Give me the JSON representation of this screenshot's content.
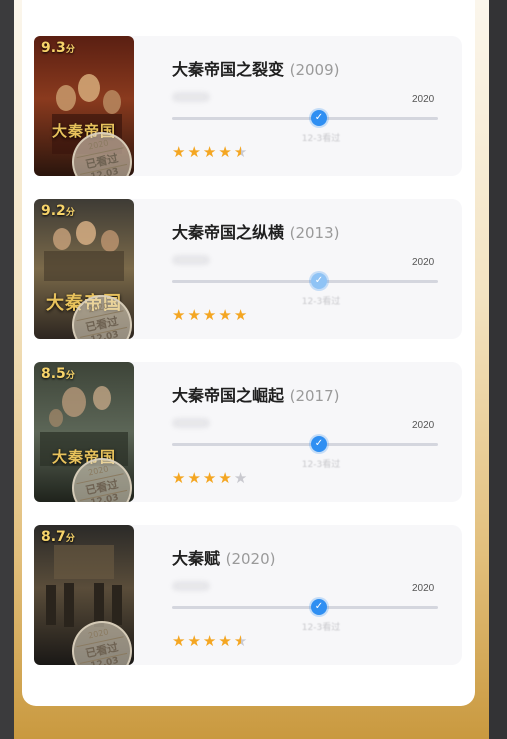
{
  "movies": [
    {
      "score": "9.3",
      "score_unit": "分",
      "poster_title": "大秦帝国",
      "title": "大秦帝国之裂变",
      "year": "(2009)",
      "track_end_label": "2020",
      "knob_label": "12-3看过",
      "rating": 4.5,
      "stamp": {
        "year": "2020",
        "text": "已看过",
        "date": "12.03"
      },
      "colors": {
        "top": "#5a1f12",
        "mid": "#8a3a1e",
        "bottom": "#2a150d"
      }
    },
    {
      "score": "9.2",
      "score_unit": "分",
      "poster_title": "大秦帝国",
      "title": "大秦帝国之纵横",
      "year": "(2013)",
      "track_end_label": "2020",
      "knob_label": "12-3看过",
      "rating": 5,
      "stamp": {
        "year": "2020",
        "text": "已看过",
        "date": "12.03"
      },
      "colors": {
        "top": "#3e3b35",
        "mid": "#7b6a4a",
        "bottom": "#2d2620"
      }
    },
    {
      "score": "8.5",
      "score_unit": "分",
      "poster_title": "大秦帝国",
      "title": "大秦帝国之崛起",
      "year": "(2017)",
      "track_end_label": "2020",
      "knob_label": "12-3看过",
      "rating": 4,
      "stamp": {
        "year": "2020",
        "text": "已看过",
        "date": "12.03"
      },
      "colors": {
        "top": "#3d4438",
        "mid": "#5c6657",
        "bottom": "#1f231c"
      }
    },
    {
      "score": "8.7",
      "score_unit": "分",
      "poster_title": "",
      "title": "大秦赋",
      "year": "(2020)",
      "track_end_label": "2020",
      "knob_label": "12-3看过",
      "rating": 4.5,
      "stamp": {
        "year": "2020",
        "text": "已看过",
        "date": "12.03"
      },
      "colors": {
        "top": "#2b2a28",
        "mid": "#5a4d3a",
        "bottom": "#1a1816"
      }
    }
  ]
}
